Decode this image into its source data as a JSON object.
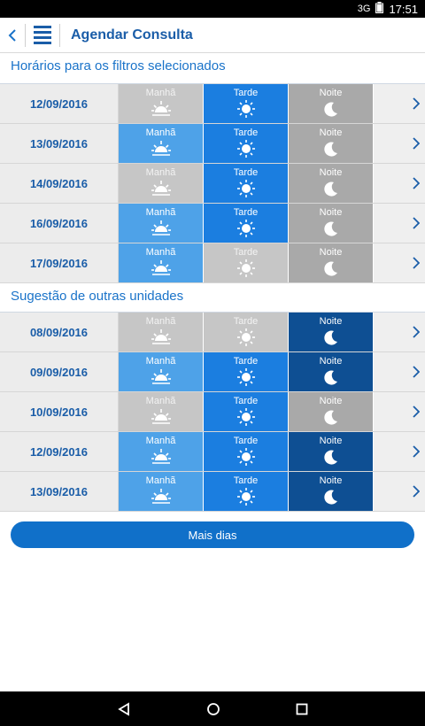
{
  "status": {
    "signal": "3G",
    "time": "17:51"
  },
  "header": {
    "title": "Agendar Consulta"
  },
  "sections": [
    {
      "title": "Horários para os filtros selecionados",
      "rows": [
        {
          "date": "12/09/2016",
          "slots": [
            {
              "label": "Manhã",
              "icon": "sunrise-icon",
              "state": "gray"
            },
            {
              "label": "Tarde",
              "icon": "sun-icon",
              "state": "blue"
            },
            {
              "label": "Noite",
              "icon": "moon-icon",
              "state": "mid"
            }
          ]
        },
        {
          "date": "13/09/2016",
          "slots": [
            {
              "label": "Manhã",
              "icon": "sunrise-icon",
              "state": "light"
            },
            {
              "label": "Tarde",
              "icon": "sun-icon",
              "state": "blue"
            },
            {
              "label": "Noite",
              "icon": "moon-icon",
              "state": "mid"
            }
          ]
        },
        {
          "date": "14/09/2016",
          "slots": [
            {
              "label": "Manhã",
              "icon": "sunrise-icon",
              "state": "gray"
            },
            {
              "label": "Tarde",
              "icon": "sun-icon",
              "state": "blue"
            },
            {
              "label": "Noite",
              "icon": "moon-icon",
              "state": "mid"
            }
          ]
        },
        {
          "date": "16/09/2016",
          "slots": [
            {
              "label": "Manhã",
              "icon": "sunrise-icon",
              "state": "light"
            },
            {
              "label": "Tarde",
              "icon": "sun-icon",
              "state": "blue"
            },
            {
              "label": "Noite",
              "icon": "moon-icon",
              "state": "mid"
            }
          ]
        },
        {
          "date": "17/09/2016",
          "slots": [
            {
              "label": "Manhã",
              "icon": "sunrise-icon",
              "state": "light"
            },
            {
              "label": "Tarde",
              "icon": "sun-icon",
              "state": "gray"
            },
            {
              "label": "Noite",
              "icon": "moon-icon",
              "state": "mid"
            }
          ]
        }
      ]
    },
    {
      "title": "Sugestão de outras unidades",
      "rows": [
        {
          "date": "08/09/2016",
          "slots": [
            {
              "label": "Manhã",
              "icon": "sunrise-icon",
              "state": "gray"
            },
            {
              "label": "Tarde",
              "icon": "sun-icon",
              "state": "gray"
            },
            {
              "label": "Noite",
              "icon": "moon-icon",
              "state": "dark"
            }
          ]
        },
        {
          "date": "09/09/2016",
          "slots": [
            {
              "label": "Manhã",
              "icon": "sunrise-icon",
              "state": "light"
            },
            {
              "label": "Tarde",
              "icon": "sun-icon",
              "state": "blue"
            },
            {
              "label": "Noite",
              "icon": "moon-icon",
              "state": "dark"
            }
          ]
        },
        {
          "date": "10/09/2016",
          "slots": [
            {
              "label": "Manhã",
              "icon": "sunrise-icon",
              "state": "gray"
            },
            {
              "label": "Tarde",
              "icon": "sun-icon",
              "state": "blue"
            },
            {
              "label": "Noite",
              "icon": "moon-icon",
              "state": "mid"
            }
          ]
        },
        {
          "date": "12/09/2016",
          "slots": [
            {
              "label": "Manhã",
              "icon": "sunrise-icon",
              "state": "light"
            },
            {
              "label": "Tarde",
              "icon": "sun-icon",
              "state": "blue"
            },
            {
              "label": "Noite",
              "icon": "moon-icon",
              "state": "dark"
            }
          ]
        },
        {
          "date": "13/09/2016",
          "slots": [
            {
              "label": "Manhã",
              "icon": "sunrise-icon",
              "state": "light"
            },
            {
              "label": "Tarde",
              "icon": "sun-icon",
              "state": "blue"
            },
            {
              "label": "Noite",
              "icon": "moon-icon",
              "state": "dark"
            }
          ]
        }
      ]
    }
  ],
  "more_button": {
    "label": "Mais dias"
  },
  "colors": {
    "gray": "#c6c6c6",
    "light": "#4ea2e8",
    "blue": "#1b7ee0",
    "dark": "#0e4f93",
    "mid": "#a9a9a9"
  }
}
